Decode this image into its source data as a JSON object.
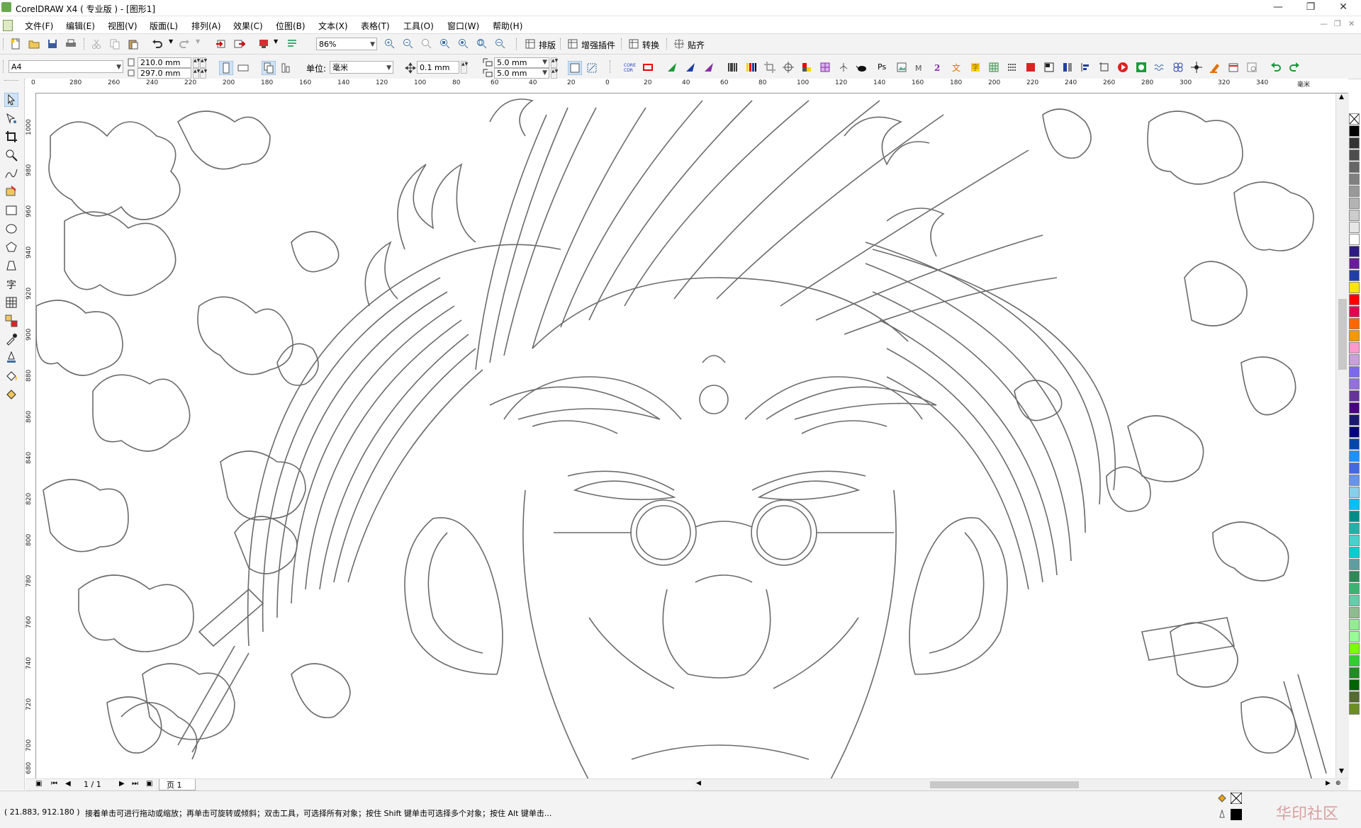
{
  "window": {
    "title": "CorelDRAW X4 ( 专业版 ) - [图形1]",
    "controls": [
      "—",
      "❐",
      "✕"
    ]
  },
  "menu": {
    "items": [
      "文件(F)",
      "编辑(E)",
      "视图(V)",
      "版面(L)",
      "排列(A)",
      "效果(C)",
      "位图(B)",
      "文本(X)",
      "表格(T)",
      "工具(O)",
      "窗口(W)",
      "帮助(H)"
    ],
    "mdi_controls": [
      "—",
      "❐",
      "✕"
    ]
  },
  "toolbar1": {
    "zoom": "86%",
    "plugins": [
      "排版",
      "增强插件",
      "转换",
      "贴齐"
    ]
  },
  "toolbar2": {
    "page_size": "A4",
    "width": "210.0 mm",
    "height": "297.0 mm",
    "unit_label": "单位:",
    "unit": "毫米",
    "nudge": "0.1 mm",
    "dup_x": "5.0 mm",
    "dup_y": "5.0 mm",
    "ps_label": "Ps"
  },
  "ruler": {
    "h_ticks": [
      "0",
      "280",
      "260",
      "240",
      "220",
      "200",
      "180",
      "160",
      "140",
      "120",
      "100",
      "80",
      "60",
      "40",
      "20",
      "0",
      "20",
      "40",
      "60",
      "80",
      "100",
      "120",
      "140",
      "160",
      "180",
      "200",
      "220",
      "240",
      "260",
      "280",
      "300",
      "320",
      "340"
    ],
    "v_ticks": [
      "1000",
      "980",
      "960",
      "940",
      "920",
      "900",
      "880",
      "860",
      "840",
      "820",
      "800",
      "780",
      "760",
      "740",
      "720",
      "700",
      "680"
    ],
    "unit_marker": "毫米"
  },
  "page_nav": {
    "counter": "1 / 1",
    "tab": "页 1"
  },
  "status": {
    "coords": "( 21.883, 912.180 )",
    "hint": "接着单击可进行拖动或缩放；再单击可旋转或倾斜；双击工具，可选择所有对象；按住 Shift 键单击可选择多个对象；按住 Alt 键单击...",
    "watermark": "华印社区"
  },
  "palette": {
    "colors": [
      "#000000",
      "#333333",
      "#4d4d4d",
      "#666666",
      "#808080",
      "#999999",
      "#b3b3b3",
      "#cccccc",
      "#e6e6e6",
      "#ffffff",
      "#2e1a80",
      "#6a1b9a",
      "#1f3fa8",
      "#ffe600",
      "#ff0000",
      "#e5004f",
      "#ff6600",
      "#f39800",
      "#ff99cc",
      "#c9a0dc",
      "#7b68ee",
      "#9370db",
      "#663399",
      "#4b0082",
      "#191970",
      "#000080",
      "#0047ab",
      "#1e90ff",
      "#4169e1",
      "#6495ed",
      "#87ceeb",
      "#00bfff",
      "#008b8b",
      "#20b2aa",
      "#48d1cc",
      "#00ced1",
      "#5f9ea0",
      "#2e8b57",
      "#3cb371",
      "#66cdaa",
      "#8fbc8f",
      "#90ee90",
      "#98fb98",
      "#7cfc00",
      "#32cd32",
      "#228b22",
      "#006400",
      "#556b2f",
      "#6b8e23"
    ]
  },
  "accent": "#3c7fb1"
}
